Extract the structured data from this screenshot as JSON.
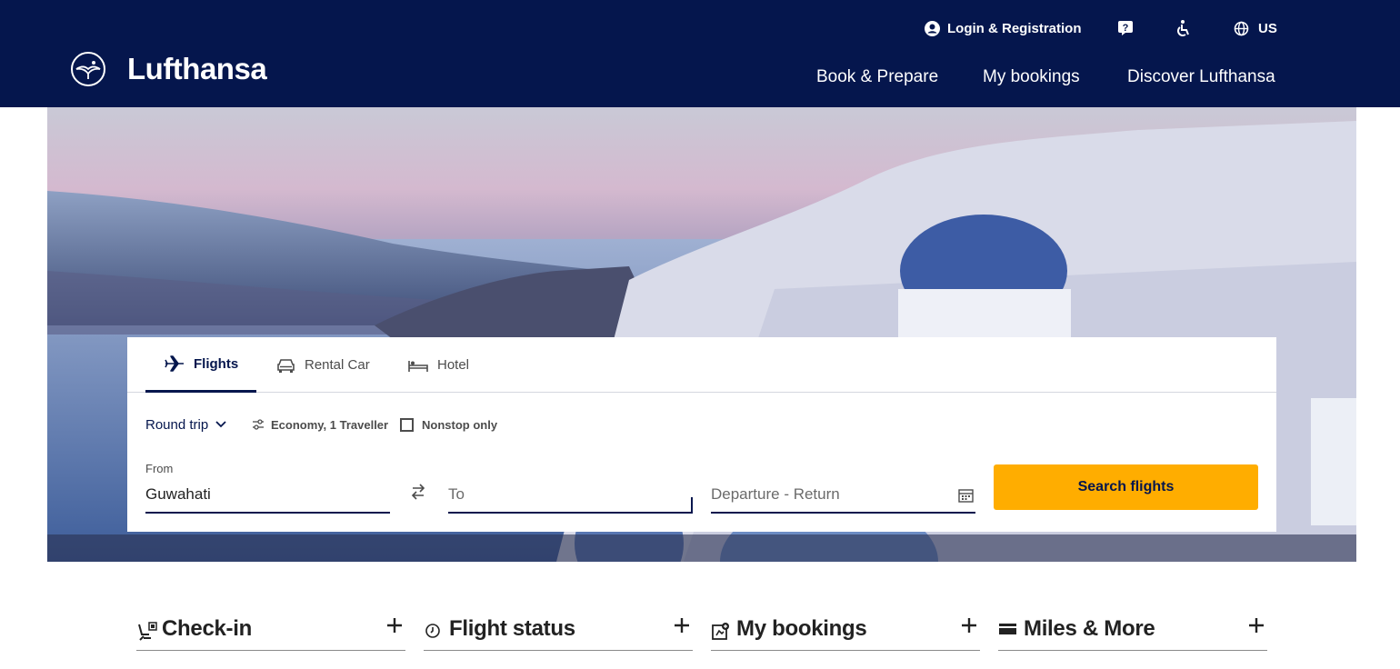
{
  "header": {
    "brand": "Lufthansa",
    "utility": {
      "login": "Login & Registration",
      "language": "US"
    },
    "nav": [
      "Book & Prepare",
      "My bookings",
      "Discover Lufthansa"
    ]
  },
  "search": {
    "tabs": [
      {
        "label": "Flights",
        "icon": "plane-icon",
        "active": true
      },
      {
        "label": "Rental Car",
        "icon": "car-icon",
        "active": false
      },
      {
        "label": "Hotel",
        "icon": "bed-icon",
        "active": false
      }
    ],
    "trip_type": "Round trip",
    "cabin": "Economy, 1 Traveller",
    "nonstop_label": "Nonstop only",
    "nonstop_checked": false,
    "from_label": "From",
    "from_value": "Guwahati",
    "to_placeholder": "To",
    "dates_placeholder": "Departure - Return",
    "submit": "Search flights"
  },
  "quick_links": [
    {
      "label": "Check-in",
      "icon": "check-in-icon"
    },
    {
      "label": "Flight status",
      "icon": "clock-icon"
    },
    {
      "label": "My bookings",
      "icon": "booking-icon"
    },
    {
      "label": "Miles & More",
      "icon": "card-icon"
    }
  ],
  "colors": {
    "header_bg": "#05164d",
    "accent": "#ffad00",
    "text_dark": "#05164d"
  }
}
